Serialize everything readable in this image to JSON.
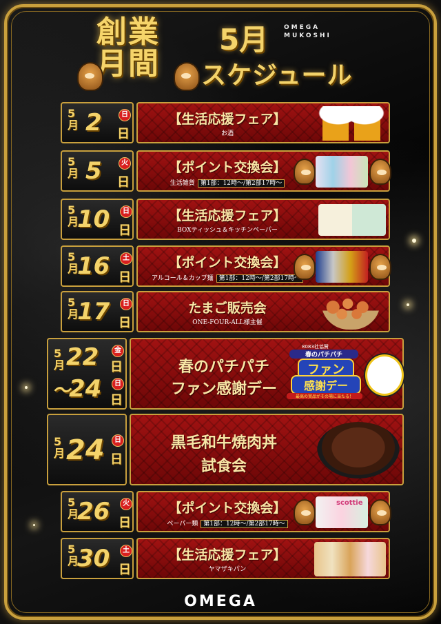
{
  "header": {
    "logo_line1": "創業",
    "logo_line2": "月間",
    "brand_line1": "OMEGA",
    "brand_line2": "MUKOSHI",
    "month": "5月",
    "schedule_title": "スケジュール"
  },
  "rows": [
    {
      "month": "5",
      "month_kanji": "月",
      "day": "2",
      "nichi": "日",
      "dow": "日",
      "title": "【生活応援フェア】",
      "subtitle": "お酒",
      "note": ""
    },
    {
      "month": "5",
      "month_kanji": "月",
      "day": "5",
      "nichi": "日",
      "dow": "火",
      "title": "【ポイント交換会】",
      "subtitle": "生活雑貨",
      "note": "第1部：12時～/第2部17時～"
    },
    {
      "month": "5",
      "month_kanji": "月",
      "day": "10",
      "nichi": "日",
      "dow": "日",
      "title": "【生活応援フェア】",
      "subtitle": "BOXティッシュ＆キッチンペーパー",
      "note": ""
    },
    {
      "month": "5",
      "month_kanji": "月",
      "day": "16",
      "nichi": "日",
      "dow": "土",
      "title": "【ポイント交換会】",
      "subtitle": "アルコール＆カップ麺",
      "note": "第1部：12時～/第2部17時～"
    },
    {
      "month": "5",
      "month_kanji": "月",
      "day": "17",
      "nichi": "日",
      "dow": "日",
      "title": "たまご販売会",
      "subtitle": "ONE-FOUR-ALL様主催",
      "note": ""
    },
    {
      "month": "5",
      "month_kanji": "月",
      "day": "22",
      "nichi": "日",
      "dow": "金",
      "day2": "24",
      "nichi2": "日",
      "dow2": "日",
      "range_mark": "～",
      "title": "春のパチパチ",
      "title2": "ファン感謝デー",
      "subtitle": "",
      "note": "",
      "badge_top": "8083社協賛",
      "badge_main1": "春のパチパチ",
      "badge_main2": "ファン",
      "badge_main3": "感謝デー",
      "badge_bottom": "最高の賞品がその場に当たる！"
    },
    {
      "month": "5",
      "month_kanji": "月",
      "day": "24",
      "nichi": "日",
      "dow": "日",
      "title": "黒毛和牛焼肉丼",
      "title2": "試食会",
      "subtitle": "",
      "note": ""
    },
    {
      "month": "5",
      "month_kanji": "月",
      "day": "26",
      "nichi": "日",
      "dow": "火",
      "title": "【ポイント交換会】",
      "subtitle": "ペーパー類",
      "note": "第1部：12時～/第2部17時～",
      "product_label": "scottie"
    },
    {
      "month": "5",
      "month_kanji": "月",
      "day": "30",
      "nichi": "日",
      "dow": "土",
      "title": "【生活応援フェア】",
      "subtitle": "ヤマザキパン",
      "note": ""
    }
  ],
  "footer": {
    "brand": "OMEGA"
  },
  "colors": {
    "gold": "#c9a03d",
    "gold_text": "#f4d36a",
    "red_panel": "#8f0f0f",
    "dow_red": "#d81f1f"
  }
}
